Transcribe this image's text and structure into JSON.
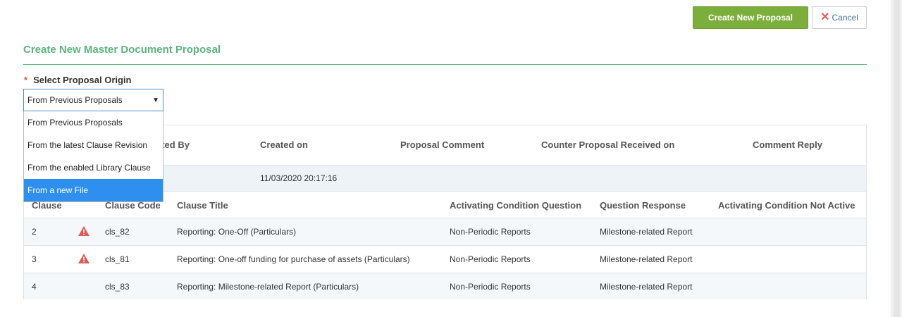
{
  "header": {
    "create_label": "Create New Proposal",
    "cancel_label": "Cancel"
  },
  "page": {
    "title": "Create New Master Document Proposal"
  },
  "origin": {
    "required_mark": "*",
    "label": "Select Proposal Origin",
    "selected": "From Previous Proposals",
    "options": [
      "From Previous Proposals",
      "From the latest Clause Revision",
      "From the enabled Library Clause",
      "From a new File"
    ],
    "highlighted_option": "From a new File"
  },
  "proposals_table": {
    "columns": [
      "Created By",
      "Created on",
      "Proposal Comment",
      "Counter Proposal Received on",
      "Comment Reply"
    ],
    "visible_header_fragment": "ated By",
    "rows": [
      {
        "created_on": "11/03/2020 20:17:16"
      }
    ]
  },
  "clauses_table": {
    "columns": [
      "Clause",
      "Clause Code",
      "Clause Title",
      "Activating Condition Question",
      "Question Response",
      "Activating Condition Not Active"
    ],
    "rows": [
      {
        "clause": "2",
        "warning": true,
        "code": "cls_82",
        "title": "Reporting: One-Off (Particulars)",
        "question": "Non-Periodic Reports",
        "response": "Milestone-related Report",
        "not_active": ""
      },
      {
        "clause": "3",
        "warning": true,
        "code": "cls_81",
        "title": "Reporting: One-off funding for purchase of assets (Particulars)",
        "question": "Non-Periodic Reports",
        "response": "Milestone-related Report",
        "not_active": ""
      },
      {
        "clause": "4",
        "warning": false,
        "code": "cls_83",
        "title": "Reporting: Milestone-related Report (Particulars)",
        "question": "Non-Periodic Reports",
        "response": "Milestone-related Report",
        "not_active": ""
      }
    ]
  },
  "colors": {
    "accent_green": "#7bae3a",
    "title_green": "#5cb37f",
    "select_highlight": "#2f8fef",
    "warning_red": "#e05a5a"
  }
}
